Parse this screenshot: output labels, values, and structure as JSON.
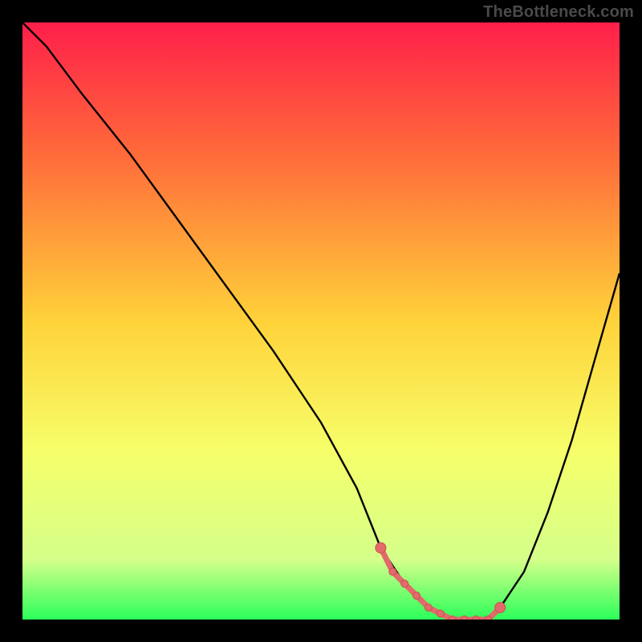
{
  "watermark": "TheBottleneck.com",
  "colors": {
    "frame_bg": "#000000",
    "gradient_top": "#ff1f4a",
    "gradient_mid_upper": "#ff6a3a",
    "gradient_mid": "#ffd23a",
    "gradient_lower": "#f6ff6a",
    "gradient_near_bottom": "#d4ff8a",
    "gradient_bottom": "#2bff5a",
    "curve": "#000000",
    "marker_fill": "#e36a6a",
    "marker_stroke": "#c94f4f"
  },
  "chart_data": {
    "type": "line",
    "title": "",
    "xlabel": "",
    "ylabel": "",
    "xlim": [
      0,
      100
    ],
    "ylim": [
      0,
      100
    ],
    "curve": {
      "name": "bottleneck-curve",
      "x": [
        0,
        4,
        10,
        18,
        26,
        34,
        42,
        50,
        56,
        58,
        60,
        64,
        68,
        72,
        76,
        78,
        80,
        84,
        88,
        92,
        96,
        100
      ],
      "y": [
        100,
        96,
        88,
        78,
        67,
        56,
        45,
        33,
        22,
        17,
        12,
        6,
        2,
        0,
        0,
        0,
        2,
        8,
        18,
        30,
        44,
        58
      ]
    },
    "markers": {
      "name": "valley-points",
      "x": [
        60,
        62,
        64,
        66,
        68,
        70,
        72,
        74,
        76,
        78,
        80
      ],
      "y": [
        12,
        8,
        6,
        4,
        2,
        1,
        0,
        0,
        0,
        0,
        2
      ]
    }
  }
}
